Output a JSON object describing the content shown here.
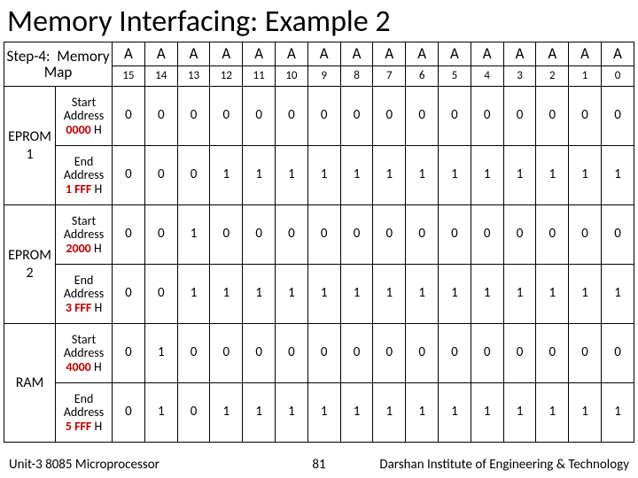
{
  "title": "Memory Interfacing: Example 2",
  "header": {
    "line1a": "Step-4:",
    "line1b": "Memory",
    "line2": "Map",
    "a_label": "A",
    "bits": [
      "15",
      "14",
      "13",
      "12",
      "11",
      "10",
      "9",
      "8",
      "7",
      "6",
      "5",
      "4",
      "3",
      "2",
      "1",
      "0"
    ]
  },
  "blocks": [
    {
      "name_l1": "EPROM",
      "name_l2": "1",
      "start": {
        "w1": "Start",
        "w2": "Address",
        "addr": "0000",
        "suffix": " H",
        "bits": [
          "0",
          "0",
          "0",
          "0",
          "0",
          "0",
          "0",
          "0",
          "0",
          "0",
          "0",
          "0",
          "0",
          "0",
          "0",
          "0"
        ]
      },
      "end": {
        "w1": "End",
        "w2": "Address",
        "addr": "1 FFF",
        "suffix": " H",
        "bits": [
          "0",
          "0",
          "0",
          "1",
          "1",
          "1",
          "1",
          "1",
          "1",
          "1",
          "1",
          "1",
          "1",
          "1",
          "1",
          "1"
        ]
      }
    },
    {
      "name_l1": "EPROM",
      "name_l2": "2",
      "start": {
        "w1": "Start",
        "w2": "Address",
        "addr": "2000",
        "suffix": " H",
        "bits": [
          "0",
          "0",
          "1",
          "0",
          "0",
          "0",
          "0",
          "0",
          "0",
          "0",
          "0",
          "0",
          "0",
          "0",
          "0",
          "0"
        ]
      },
      "end": {
        "w1": "End",
        "w2": "Address",
        "addr": "3 FFF",
        "suffix": " H",
        "bits": [
          "0",
          "0",
          "1",
          "1",
          "1",
          "1",
          "1",
          "1",
          "1",
          "1",
          "1",
          "1",
          "1",
          "1",
          "1",
          "1"
        ]
      }
    },
    {
      "name_l1": "RAM",
      "name_l2": "",
      "start": {
        "w1": "Start",
        "w2": "Address",
        "addr": "4000",
        "suffix": " H",
        "bits": [
          "0",
          "1",
          "0",
          "0",
          "0",
          "0",
          "0",
          "0",
          "0",
          "0",
          "0",
          "0",
          "0",
          "0",
          "0",
          "0"
        ]
      },
      "end": {
        "w1": "End",
        "w2": "Address",
        "addr": "5 FFF",
        "suffix": " H",
        "bits": [
          "0",
          "1",
          "0",
          "1",
          "1",
          "1",
          "1",
          "1",
          "1",
          "1",
          "1",
          "1",
          "1",
          "1",
          "1",
          "1"
        ]
      }
    }
  ],
  "footer": {
    "left": "Unit-3 8085 Microprocessor",
    "page": "81",
    "right": "Darshan Institute of Engineering & Technology"
  },
  "chart_data": {
    "type": "table",
    "title": "Step-4: Memory Map",
    "address_bits": [
      "A15",
      "A14",
      "A13",
      "A12",
      "A11",
      "A10",
      "A9",
      "A8",
      "A7",
      "A6",
      "A5",
      "A4",
      "A3",
      "A2",
      "A1",
      "A0"
    ],
    "rows": [
      {
        "device": "EPROM 1",
        "label": "Start Address 0000 H",
        "bits": [
          0,
          0,
          0,
          0,
          0,
          0,
          0,
          0,
          0,
          0,
          0,
          0,
          0,
          0,
          0,
          0
        ]
      },
      {
        "device": "EPROM 1",
        "label": "End Address 1FFF H",
        "bits": [
          0,
          0,
          0,
          1,
          1,
          1,
          1,
          1,
          1,
          1,
          1,
          1,
          1,
          1,
          1,
          1
        ]
      },
      {
        "device": "EPROM 2",
        "label": "Start Address 2000 H",
        "bits": [
          0,
          0,
          1,
          0,
          0,
          0,
          0,
          0,
          0,
          0,
          0,
          0,
          0,
          0,
          0,
          0
        ]
      },
      {
        "device": "EPROM 2",
        "label": "End Address 3FFF H",
        "bits": [
          0,
          0,
          1,
          1,
          1,
          1,
          1,
          1,
          1,
          1,
          1,
          1,
          1,
          1,
          1,
          1
        ]
      },
      {
        "device": "RAM",
        "label": "Start Address 4000 H",
        "bits": [
          0,
          1,
          0,
          0,
          0,
          0,
          0,
          0,
          0,
          0,
          0,
          0,
          0,
          0,
          0,
          0
        ]
      },
      {
        "device": "RAM",
        "label": "End Address 5FFF H",
        "bits": [
          0,
          1,
          0,
          1,
          1,
          1,
          1,
          1,
          1,
          1,
          1,
          1,
          1,
          1,
          1,
          1
        ]
      }
    ]
  }
}
